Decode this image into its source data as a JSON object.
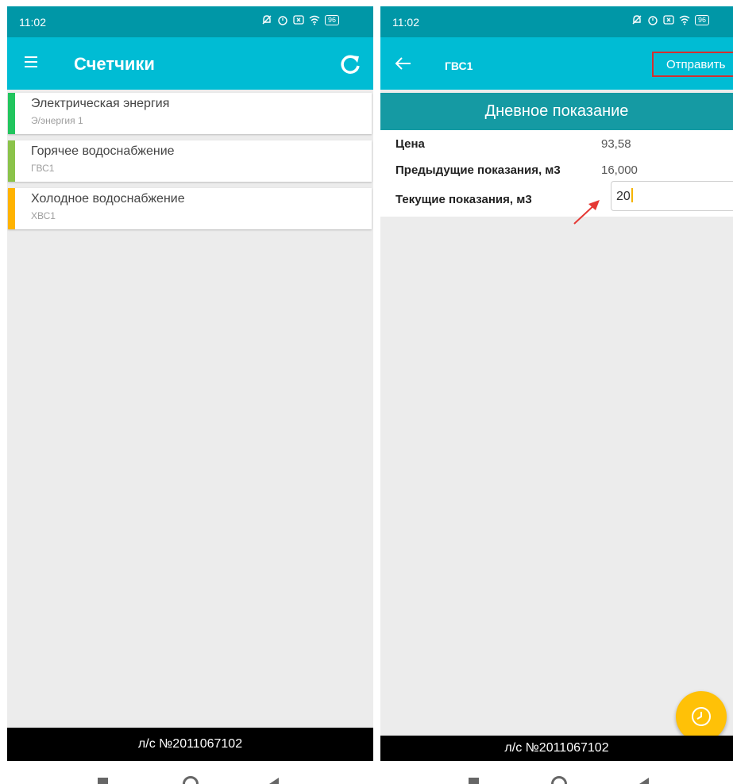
{
  "left": {
    "status_time": "11:02",
    "battery": "96",
    "title": "Счетчики",
    "meters": [
      {
        "name": "Электрическая энергия",
        "sub": "Э/энергия 1",
        "color": "#22c55e"
      },
      {
        "name": "Горячее водоснабжение",
        "sub": "ГВС1",
        "color": "#8bc34a"
      },
      {
        "name": "Холодное водоснабжение",
        "sub": "ХВС1",
        "color": "#ffb300"
      }
    ],
    "footer": "л/с №2011067102"
  },
  "right": {
    "status_time": "11:02",
    "battery": "96",
    "title": "ГВС1",
    "send_label": "Отправить",
    "section_title": "Дневное показание",
    "price_label": "Цена",
    "price_value": "93,58",
    "prev_label": "Предыдущие показания, м3",
    "prev_value": "16,000",
    "current_label": "Текущие показания, м3",
    "current_value": "20",
    "footer": "л/с №2011067102"
  },
  "colors": {
    "statusbar": "#0097a7",
    "appbar": "#00bcd4",
    "section_header": "#159aa3",
    "fab": "#ffc107",
    "highlight": "#d32f2f"
  },
  "icons": [
    "menu-icon",
    "refresh-icon",
    "back-arrow-icon",
    "clock-icon"
  ]
}
